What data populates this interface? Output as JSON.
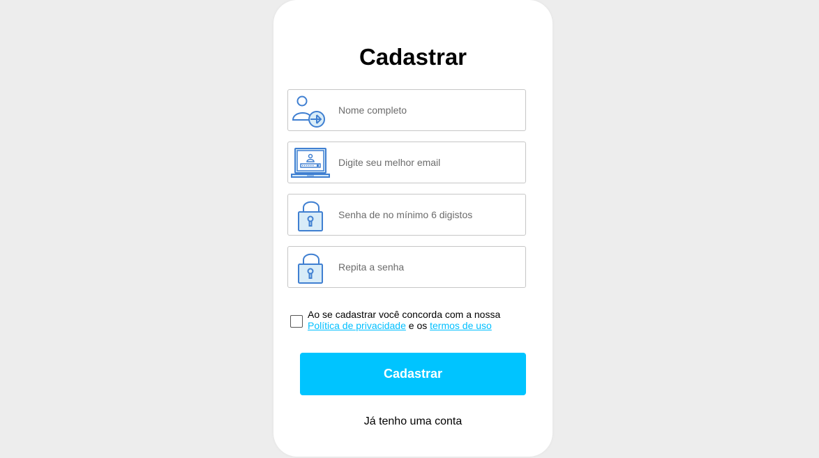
{
  "form": {
    "title": "Cadastrar",
    "fields": [
      {
        "icon": "user-add-icon",
        "placeholder": "Nome completo",
        "value": ""
      },
      {
        "icon": "laptop-login-icon",
        "placeholder": "Digite seu melhor email",
        "value": ""
      },
      {
        "icon": "lock-icon",
        "placeholder": "Senha de no mínimo 6 digistos",
        "value": ""
      },
      {
        "icon": "lock-icon",
        "placeholder": "Repita a senha",
        "value": ""
      }
    ],
    "terms": {
      "text_before": "Ao se cadastrar você concorda com a nossa ",
      "privacy_link": "Política de privacidade",
      "text_middle": " e os ",
      "terms_link": "termos de uso",
      "checked": false
    },
    "submit_label": "Cadastrar",
    "login_link": "Já tenho uma conta"
  },
  "colors": {
    "background": "#ededed",
    "card": "#ffffff",
    "accent": "#00c4ff",
    "link": "#00bfff",
    "icon_stroke": "#3f7fd1",
    "icon_fill": "#d8ecf8"
  }
}
